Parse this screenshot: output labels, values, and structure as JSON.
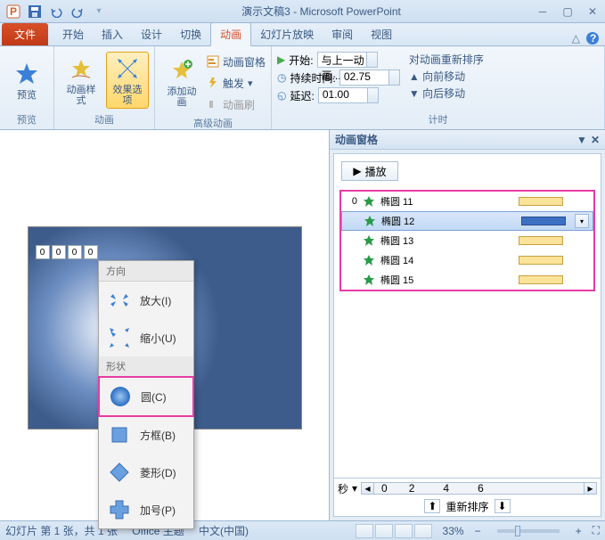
{
  "title": "演示文稿3 - Microsoft PowerPoint",
  "tabs": {
    "file": "文件",
    "home": "开始",
    "insert": "插入",
    "design": "设计",
    "trans": "切换",
    "anim": "动画",
    "slideshow": "幻灯片放映",
    "review": "审阅",
    "view": "视图"
  },
  "ribbon": {
    "preview": {
      "label": "预览",
      "grp": "预览"
    },
    "animation": {
      "style": "动画样式",
      "effect": "效果选项",
      "grp": "动画"
    },
    "advanced": {
      "add": "添加动画",
      "pane": "动画窗格",
      "trigger": "触发",
      "painter": "动画刷",
      "grp": "高级动画"
    },
    "timing": {
      "start": "开始:",
      "startval": "与上一动画...",
      "duration": "持续时间:",
      "durval": "02.75",
      "delay": "延迟:",
      "delayval": "01.00",
      "grp": "计时"
    },
    "reorder": {
      "title": "对动画重新排序",
      "fwd": "向前移动",
      "back": "向后移动"
    }
  },
  "dropdown": {
    "direction": "方向",
    "expand": "放大(I)",
    "shrink": "缩小(U)",
    "shape": "形状",
    "circle": "圆(C)",
    "square": "方框(B)",
    "diamond": "菱形(D)",
    "plus": "加号(P)"
  },
  "pane": {
    "title": "动画窗格",
    "play": "播放",
    "items": [
      {
        "idx": "0",
        "name": "椭圆 11"
      },
      {
        "idx": "",
        "name": "椭圆 12",
        "selected": true
      },
      {
        "idx": "",
        "name": "椭圆 13"
      },
      {
        "idx": "",
        "name": "椭圆 14"
      },
      {
        "idx": "",
        "name": "椭圆 15"
      }
    ],
    "seconds": "秒",
    "reorder": "重新排序",
    "ticks": [
      "0",
      "2",
      "4",
      "6"
    ]
  },
  "status": {
    "slide": "幻灯片 第 1 张，共 1 张",
    "theme": "\"Office 主题\"",
    "lang": "中文(中国)",
    "zoom": "33%"
  },
  "slide_tags": [
    "0",
    "0",
    "0",
    "0"
  ]
}
